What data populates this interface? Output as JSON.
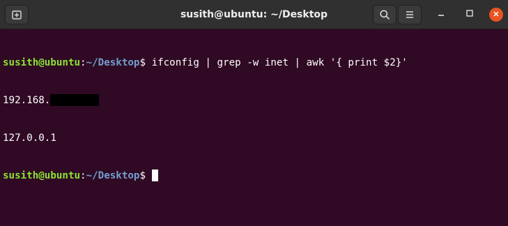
{
  "window": {
    "title": "susith@ubuntu: ~/Desktop"
  },
  "icons": {
    "new_tab": "new-tab-icon",
    "search": "search-icon",
    "menu": "hamburger-menu-icon",
    "minimize": "minimize-icon",
    "maximize": "maximize-icon",
    "close": "close-icon"
  },
  "colors": {
    "terminal_bg": "#300a24",
    "user_host": "#8ae234",
    "path": "#729fcf",
    "close_button": "#e95420"
  },
  "terminal": {
    "prompt": {
      "user_host": "susith@ubuntu",
      "separator": ":",
      "path": "~/Desktop",
      "symbol": "$ "
    },
    "command": "ifconfig | grep -w inet | awk '{ print $2}'",
    "output": [
      "192.168.",
      "127.0.0.1"
    ]
  }
}
